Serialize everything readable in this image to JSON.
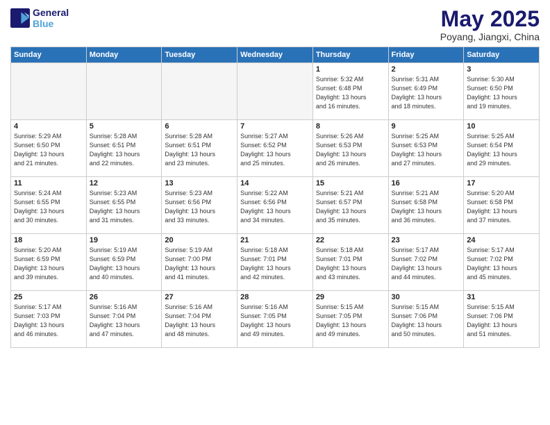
{
  "logo": {
    "line1": "General",
    "line2": "Blue"
  },
  "title": "May 2025",
  "subtitle": "Poyang, Jiangxi, China",
  "weekdays": [
    "Sunday",
    "Monday",
    "Tuesday",
    "Wednesday",
    "Thursday",
    "Friday",
    "Saturday"
  ],
  "weeks": [
    [
      {
        "day": "",
        "info": ""
      },
      {
        "day": "",
        "info": ""
      },
      {
        "day": "",
        "info": ""
      },
      {
        "day": "",
        "info": ""
      },
      {
        "day": "1",
        "info": "Sunrise: 5:32 AM\nSunset: 6:48 PM\nDaylight: 13 hours\nand 16 minutes."
      },
      {
        "day": "2",
        "info": "Sunrise: 5:31 AM\nSunset: 6:49 PM\nDaylight: 13 hours\nand 18 minutes."
      },
      {
        "day": "3",
        "info": "Sunrise: 5:30 AM\nSunset: 6:50 PM\nDaylight: 13 hours\nand 19 minutes."
      }
    ],
    [
      {
        "day": "4",
        "info": "Sunrise: 5:29 AM\nSunset: 6:50 PM\nDaylight: 13 hours\nand 21 minutes."
      },
      {
        "day": "5",
        "info": "Sunrise: 5:28 AM\nSunset: 6:51 PM\nDaylight: 13 hours\nand 22 minutes."
      },
      {
        "day": "6",
        "info": "Sunrise: 5:28 AM\nSunset: 6:51 PM\nDaylight: 13 hours\nand 23 minutes."
      },
      {
        "day": "7",
        "info": "Sunrise: 5:27 AM\nSunset: 6:52 PM\nDaylight: 13 hours\nand 25 minutes."
      },
      {
        "day": "8",
        "info": "Sunrise: 5:26 AM\nSunset: 6:53 PM\nDaylight: 13 hours\nand 26 minutes."
      },
      {
        "day": "9",
        "info": "Sunrise: 5:25 AM\nSunset: 6:53 PM\nDaylight: 13 hours\nand 27 minutes."
      },
      {
        "day": "10",
        "info": "Sunrise: 5:25 AM\nSunset: 6:54 PM\nDaylight: 13 hours\nand 29 minutes."
      }
    ],
    [
      {
        "day": "11",
        "info": "Sunrise: 5:24 AM\nSunset: 6:55 PM\nDaylight: 13 hours\nand 30 minutes."
      },
      {
        "day": "12",
        "info": "Sunrise: 5:23 AM\nSunset: 6:55 PM\nDaylight: 13 hours\nand 31 minutes."
      },
      {
        "day": "13",
        "info": "Sunrise: 5:23 AM\nSunset: 6:56 PM\nDaylight: 13 hours\nand 33 minutes."
      },
      {
        "day": "14",
        "info": "Sunrise: 5:22 AM\nSunset: 6:56 PM\nDaylight: 13 hours\nand 34 minutes."
      },
      {
        "day": "15",
        "info": "Sunrise: 5:21 AM\nSunset: 6:57 PM\nDaylight: 13 hours\nand 35 minutes."
      },
      {
        "day": "16",
        "info": "Sunrise: 5:21 AM\nSunset: 6:58 PM\nDaylight: 13 hours\nand 36 minutes."
      },
      {
        "day": "17",
        "info": "Sunrise: 5:20 AM\nSunset: 6:58 PM\nDaylight: 13 hours\nand 37 minutes."
      }
    ],
    [
      {
        "day": "18",
        "info": "Sunrise: 5:20 AM\nSunset: 6:59 PM\nDaylight: 13 hours\nand 39 minutes."
      },
      {
        "day": "19",
        "info": "Sunrise: 5:19 AM\nSunset: 6:59 PM\nDaylight: 13 hours\nand 40 minutes."
      },
      {
        "day": "20",
        "info": "Sunrise: 5:19 AM\nSunset: 7:00 PM\nDaylight: 13 hours\nand 41 minutes."
      },
      {
        "day": "21",
        "info": "Sunrise: 5:18 AM\nSunset: 7:01 PM\nDaylight: 13 hours\nand 42 minutes."
      },
      {
        "day": "22",
        "info": "Sunrise: 5:18 AM\nSunset: 7:01 PM\nDaylight: 13 hours\nand 43 minutes."
      },
      {
        "day": "23",
        "info": "Sunrise: 5:17 AM\nSunset: 7:02 PM\nDaylight: 13 hours\nand 44 minutes."
      },
      {
        "day": "24",
        "info": "Sunrise: 5:17 AM\nSunset: 7:02 PM\nDaylight: 13 hours\nand 45 minutes."
      }
    ],
    [
      {
        "day": "25",
        "info": "Sunrise: 5:17 AM\nSunset: 7:03 PM\nDaylight: 13 hours\nand 46 minutes."
      },
      {
        "day": "26",
        "info": "Sunrise: 5:16 AM\nSunset: 7:04 PM\nDaylight: 13 hours\nand 47 minutes."
      },
      {
        "day": "27",
        "info": "Sunrise: 5:16 AM\nSunset: 7:04 PM\nDaylight: 13 hours\nand 48 minutes."
      },
      {
        "day": "28",
        "info": "Sunrise: 5:16 AM\nSunset: 7:05 PM\nDaylight: 13 hours\nand 49 minutes."
      },
      {
        "day": "29",
        "info": "Sunrise: 5:15 AM\nSunset: 7:05 PM\nDaylight: 13 hours\nand 49 minutes."
      },
      {
        "day": "30",
        "info": "Sunrise: 5:15 AM\nSunset: 7:06 PM\nDaylight: 13 hours\nand 50 minutes."
      },
      {
        "day": "31",
        "info": "Sunrise: 5:15 AM\nSunset: 7:06 PM\nDaylight: 13 hours\nand 51 minutes."
      }
    ]
  ]
}
